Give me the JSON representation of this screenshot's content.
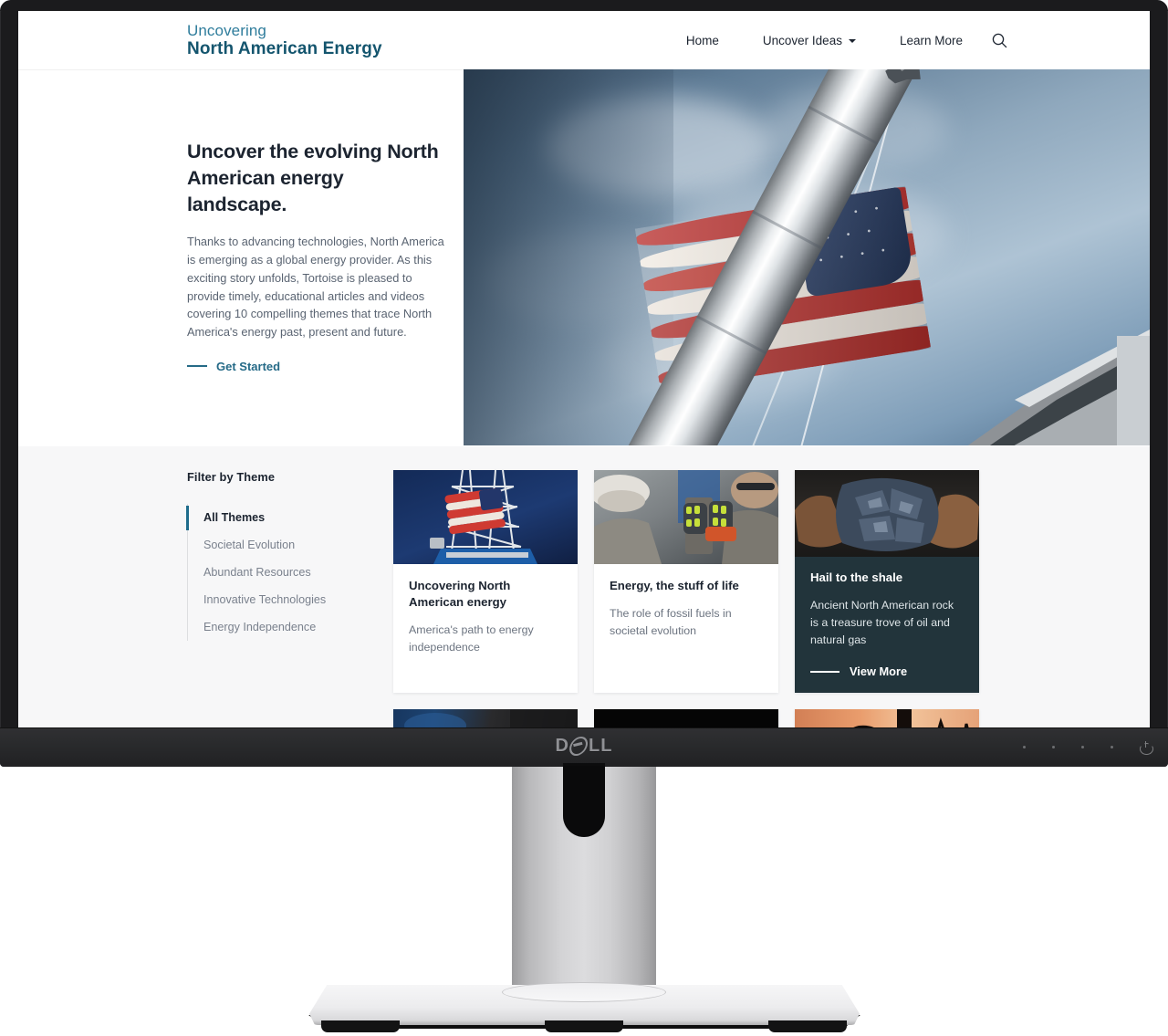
{
  "site": {
    "brand": {
      "line1": "Uncovering",
      "line2": "North American Energy"
    },
    "nav": [
      {
        "label": "Home",
        "has_chevron": false
      },
      {
        "label": "Uncover Ideas",
        "has_chevron": true
      },
      {
        "label": "Learn More",
        "has_chevron": false
      }
    ],
    "search_icon": "search-icon"
  },
  "hero": {
    "title": "Uncover the evolving North American energy landscape.",
    "body": "Thanks to advancing technologies, North America is emerging as a global energy provider. As this exciting story unfolds, Tortoise is pleased to provide timely, educational articles and videos covering 10 compelling themes that trace North America's energy past, present and future.",
    "cta": "Get Started",
    "image_alt": "american-flag-on-flagpole"
  },
  "filter": {
    "title": "Filter by Theme",
    "items": [
      {
        "label": "All Themes",
        "active": true
      },
      {
        "label": "Societal Evolution",
        "active": false
      },
      {
        "label": "Abundant Resources",
        "active": false
      },
      {
        "label": "Innovative Technologies",
        "active": false
      },
      {
        "label": "Energy Independence",
        "active": false
      }
    ]
  },
  "cards": [
    {
      "title": "Uncovering North American energy",
      "subtitle": "America's path to energy independence",
      "style": "light",
      "image_alt": "drilling-rig-with-flag"
    },
    {
      "title": "Energy, the stuff of life",
      "subtitle": "The role of fossil fuels in societal evolution",
      "style": "light",
      "image_alt": "oil-workers-gloves"
    },
    {
      "title": "Hail to the shale",
      "subtitle": "Ancient North American rock is a treasure trove of oil and natural gas",
      "style": "dark",
      "cta": "View More",
      "image_alt": "hands-holding-shale-rock"
    }
  ],
  "cards_row2": [
    {
      "image_alt": "gas-flare-night-sky"
    },
    {
      "image_alt": "dark-thumbnail"
    },
    {
      "image_alt": "sunset-oil-pumpjack-silhouette"
    }
  ],
  "monitor": {
    "brand": "D",
    "brand_tail": "LL",
    "power_icon": "power-icon",
    "indicator_dots": 4
  },
  "colors": {
    "brand_light": "#2f7d9c",
    "brand_dark": "#14556e",
    "accent": "#1e6c8c",
    "text": "#1c2430",
    "muted": "#6c7480",
    "panel_bg": "#f7f7f8",
    "dark_card": "#22343b"
  }
}
